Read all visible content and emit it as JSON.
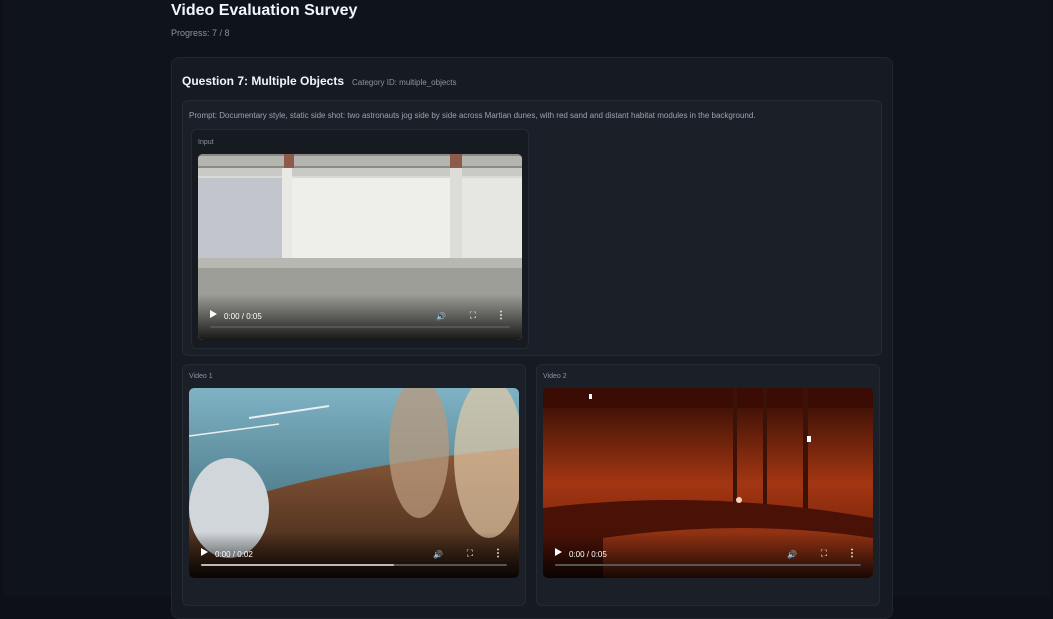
{
  "header": {
    "title": "Video Evaluation Survey",
    "progress": "Progress: 7 / 8"
  },
  "question": {
    "title": "Question 7: Multiple Objects",
    "category": "Category ID: multiple_objects",
    "prompt": "Prompt: Documentary style, static side shot: two astronauts jog side by side across Martian dunes, with red sand and distant habitat modules in the background."
  },
  "input": {
    "label": "Input",
    "time": "0:00 / 0:05"
  },
  "videos": [
    {
      "label": "Video 1",
      "time": "0:00 / 0:02"
    },
    {
      "label": "Video 2",
      "time": "0:00 / 0:05"
    }
  ],
  "icons": {
    "play": "play-icon",
    "volume": "volume-icon",
    "fullscreen": "fullscreen-icon",
    "more": "more-icon"
  }
}
